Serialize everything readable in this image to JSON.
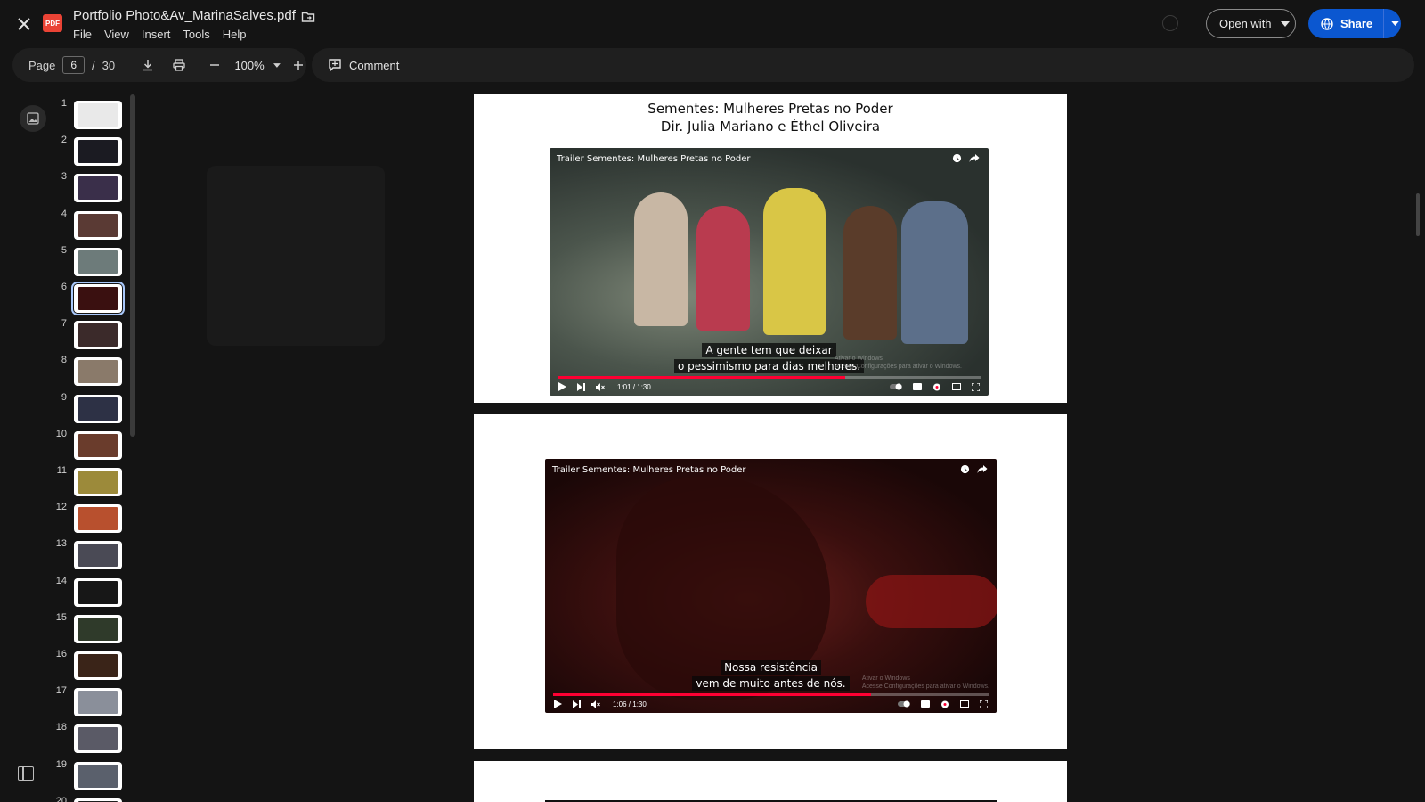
{
  "window": {
    "title": "Portfolio Photo&Av_MarinaSalves.pdf",
    "menu": [
      "File",
      "View",
      "Insert",
      "Tools",
      "Help"
    ],
    "open_with_label": "Open with",
    "share_label": "Share"
  },
  "toolbar": {
    "page_label": "Page",
    "current_page": "6",
    "page_sep": "/",
    "total_pages": "30",
    "zoom": "100%",
    "comment_label": "Comment"
  },
  "thumbnails": {
    "selected": 6,
    "items": [
      {
        "n": "1",
        "color": "#e9e9e9"
      },
      {
        "n": "2",
        "color": "#1b1b22"
      },
      {
        "n": "3",
        "color": "#3a2f4a"
      },
      {
        "n": "4",
        "color": "#5a3a34"
      },
      {
        "n": "5",
        "color": "#6d7b7a"
      },
      {
        "n": "6",
        "color": "#3a1010"
      },
      {
        "n": "7",
        "color": "#3b2a2a"
      },
      {
        "n": "8",
        "color": "#8a7a6a"
      },
      {
        "n": "9",
        "color": "#2d3145"
      },
      {
        "n": "10",
        "color": "#6a3c2c"
      },
      {
        "n": "11",
        "color": "#9c8a3a"
      },
      {
        "n": "12",
        "color": "#b8502e"
      },
      {
        "n": "13",
        "color": "#4a4a55"
      },
      {
        "n": "14",
        "color": "#171717"
      },
      {
        "n": "15",
        "color": "#2f3a2a"
      },
      {
        "n": "16",
        "color": "#3a2418"
      },
      {
        "n": "17",
        "color": "#8a8f9a"
      },
      {
        "n": "18",
        "color": "#5a5a66"
      },
      {
        "n": "19",
        "color": "#5a606c"
      },
      {
        "n": "20",
        "color": "#1e1e1e"
      }
    ]
  },
  "slides": [
    {
      "title_line1": "Sementes: Mulheres Pretas no Poder",
      "title_line2": "Dir. Julia Mariano e Éthel Oliveira",
      "video_title": "Trailer Sementes: Mulheres Pretas no Poder",
      "caption_line1": "A gente tem que deixar",
      "caption_line2": "o pessimismo para dias melhores.",
      "time": "1:01 / 1:30",
      "progress": 0.68,
      "watermark1": "Ativar o Windows",
      "watermark2": "Acesse Configurações para ativar o Windows."
    },
    {
      "video_title": "Trailer Sementes: Mulheres Pretas no Poder",
      "caption_line1": "Nossa resistência",
      "caption_line2": "vem de muito antes de nós.",
      "time": "1:06 / 1:30",
      "progress": 0.73,
      "watermark1": "Ativar o Windows",
      "watermark2": "Acesse Configurações para ativar o Windows."
    }
  ]
}
